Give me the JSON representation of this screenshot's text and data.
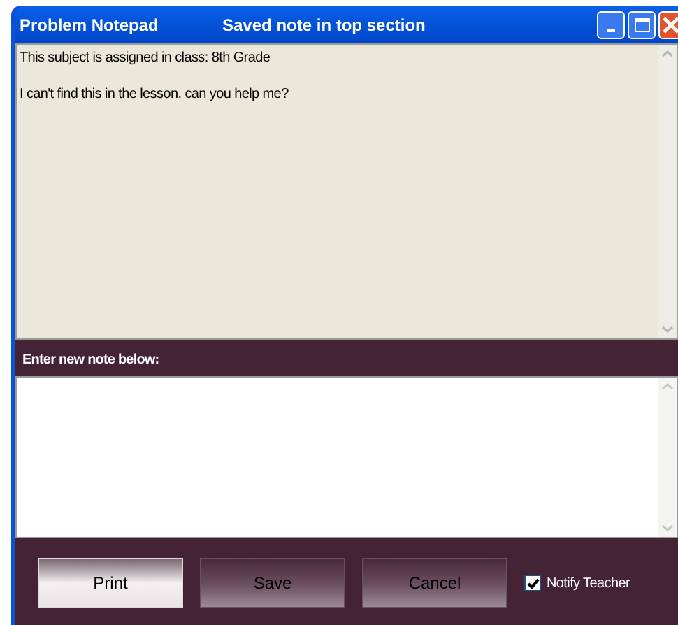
{
  "window": {
    "title": "Problem Notepad",
    "status": "Saved note in top section"
  },
  "saved_note": {
    "lines": [
      "This subject is assigned in class: 8th Grade",
      "I can't find this in the lesson. can you help me?"
    ]
  },
  "new_note": {
    "label": "Enter new note below:"
  },
  "buttons": [
    {
      "label": "Print",
      "selected": true
    },
    {
      "label": "Save",
      "selected": false
    },
    {
      "label": "Cancel",
      "selected": false
    }
  ],
  "notify_teacher": {
    "label": "Notify Teacher",
    "checked": true
  }
}
